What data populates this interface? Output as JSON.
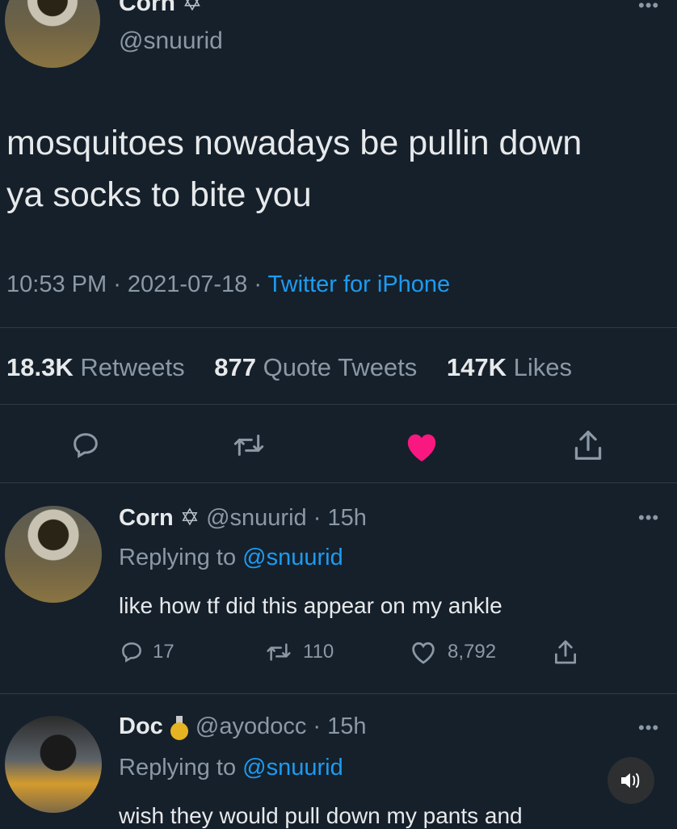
{
  "main_tweet": {
    "name": "Corn",
    "handle": "@snuurid",
    "text_line1": "mosquitoes nowadays be pullin down",
    "text_line2": "ya socks to bite you",
    "time": "10:53 PM",
    "date": "2021-07-18",
    "source": "Twitter for iPhone",
    "stats": {
      "retweets_count": "18.3K",
      "retweets_label": "Retweets",
      "quotes_count": "877",
      "quotes_label": "Quote Tweets",
      "likes_count": "147K",
      "likes_label": "Likes"
    },
    "actions": [
      "reply-icon",
      "retweet-icon",
      "heart-icon",
      "share-icon"
    ],
    "like_color": "#f91880"
  },
  "replies": [
    {
      "name": "Corn",
      "handle": "@snuurid",
      "time": "15h",
      "replying_label": "Replying to",
      "replying_to": "@snuurid",
      "text": "like how tf did this appear on my ankle",
      "reply_count": "17",
      "retweet_count": "110",
      "like_count": "8,792"
    },
    {
      "name": "Doc",
      "handle": "@ayodocc",
      "time": "15h",
      "replying_label": "Replying to",
      "replying_to": "@snuurid",
      "text": "wish they would pull down my pants and"
    }
  ],
  "colors": {
    "background": "#15202b",
    "link": "#1d9bf0",
    "muted": "#8b98a5"
  }
}
